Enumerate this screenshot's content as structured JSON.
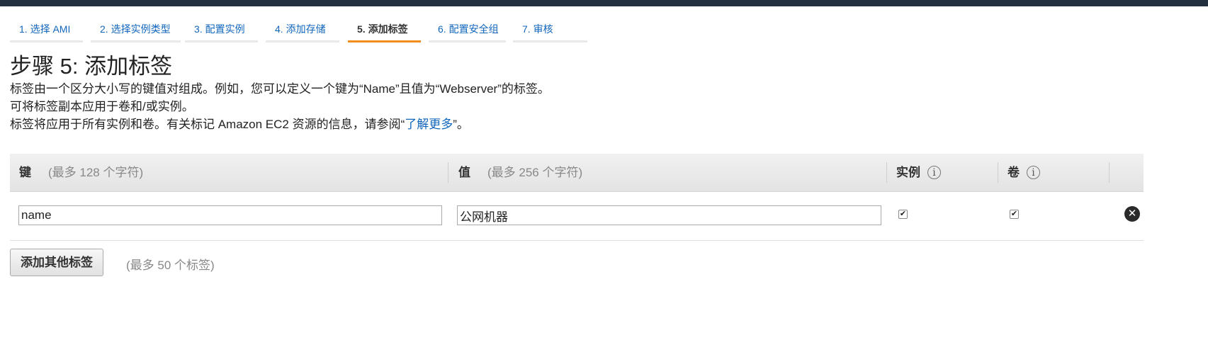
{
  "wizard": {
    "steps": [
      {
        "label": "1. 选择 AMI"
      },
      {
        "label": "2. 选择实例类型"
      },
      {
        "label": "3. 配置实例"
      },
      {
        "label": "4. 添加存储"
      },
      {
        "label": "5. 添加标签",
        "active": true
      },
      {
        "label": "6. 配置安全组"
      },
      {
        "label": "7. 审核"
      }
    ]
  },
  "page": {
    "title": "步骤 5: 添加标签",
    "desc1": "标签由一个区分大小写的键值对组成。例如，您可以定义一个键为“Name”且值为“Webserver”的标签。",
    "desc2": "可将标签副本应用于卷和/或实例。",
    "desc3_before": "标签将应用于所有实例和卷。有关标记 Amazon EC2 资源的信息，请参阅“",
    "desc3_link": "了解更多",
    "desc3_after": "”。"
  },
  "table": {
    "headers": {
      "key": "键",
      "key_hint": "(最多 128 个字符)",
      "value": "值",
      "value_hint": "(最多 256 个字符)",
      "instance": "实例",
      "volume": "卷",
      "info_icon": "i"
    },
    "rows": [
      {
        "key": "name",
        "value": "公网机器",
        "instance": true,
        "volume": true
      }
    ]
  },
  "footer": {
    "add_button": "添加其他标签",
    "limit_hint": "(最多 50 个标签)"
  },
  "icons": {
    "checkmark": "✔",
    "remove": "✕"
  },
  "colors": {
    "link": "#1166bb",
    "active_step_underline": "#f08d1c",
    "topbar": "#232f3e"
  }
}
